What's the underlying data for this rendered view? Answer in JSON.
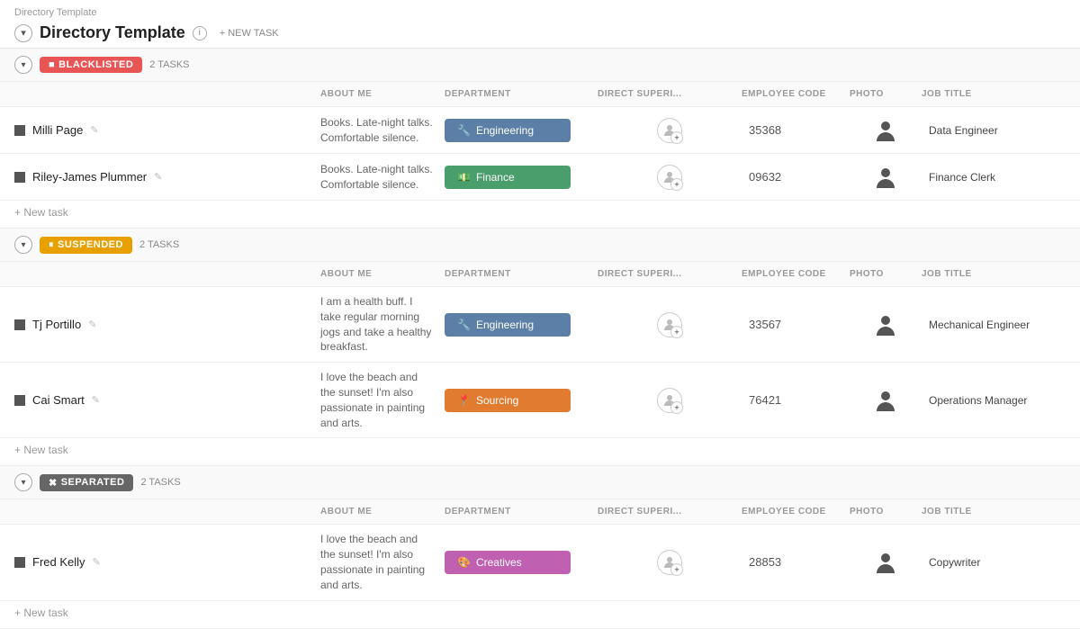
{
  "app": {
    "breadcrumb": "Directory Template",
    "title": "Directory Template",
    "info_tooltip": "i",
    "new_task_label": "+ NEW TASK"
  },
  "columns": {
    "name": "",
    "about": "ABOUT ME",
    "department": "DEPARTMENT",
    "direct_super": "DIRECT SUPERI...",
    "employee_code": "EMPLOYEE CODE",
    "photo": "PHOTO",
    "job_title": "JOB TITLE"
  },
  "sections": [
    {
      "id": "blacklisted",
      "badge_label": "BLACKLISTED",
      "badge_class": "badge-blacklisted",
      "badge_icon": "■",
      "tasks_label": "2 TASKS",
      "rows": [
        {
          "name": "Milli Page",
          "about": "Books. Late-night talks. Comfortable silence.",
          "dept_label": "Engineering",
          "dept_class": "dept-engineering",
          "dept_icon": "🔧",
          "employee_code": "35368",
          "job_title": "Data Engineer"
        },
        {
          "name": "Riley-James Plummer",
          "about": "Books. Late-night talks. Comfortable silence.",
          "dept_label": "Finance",
          "dept_class": "dept-finance",
          "dept_icon": "💵",
          "employee_code": "09632",
          "job_title": "Finance Clerk"
        }
      ],
      "new_task": "+ New task"
    },
    {
      "id": "suspended",
      "badge_label": "SUSPENDED",
      "badge_class": "badge-suspended",
      "badge_icon": "⏸",
      "tasks_label": "2 TASKS",
      "rows": [
        {
          "name": "Tj Portillo",
          "about": "I am a health buff. I take regular morning jogs and take a healthy breakfast.",
          "dept_label": "Engineering",
          "dept_class": "dept-engineering",
          "dept_icon": "🔧",
          "employee_code": "33567",
          "job_title": "Mechanical Engineer"
        },
        {
          "name": "Cai Smart",
          "about": "I love the beach and the sunset! I'm also passionate in painting and arts.",
          "dept_label": "Sourcing",
          "dept_class": "dept-sourcing",
          "dept_icon": "📍",
          "employee_code": "76421",
          "job_title": "Operations Manager"
        }
      ],
      "new_task": "+ New task"
    },
    {
      "id": "separated",
      "badge_label": "SEPARATED",
      "badge_class": "badge-separated",
      "badge_icon": "✖",
      "tasks_label": "2 TASKS",
      "rows": [
        {
          "name": "Fred Kelly",
          "about": "I love the beach and the sunset! I'm also passionate in painting and arts.",
          "dept_label": "Creatives",
          "dept_class": "dept-creatives",
          "dept_icon": "🎨",
          "employee_code": "28853",
          "job_title": "Copywriter"
        }
      ],
      "new_task": "+ New task"
    }
  ]
}
